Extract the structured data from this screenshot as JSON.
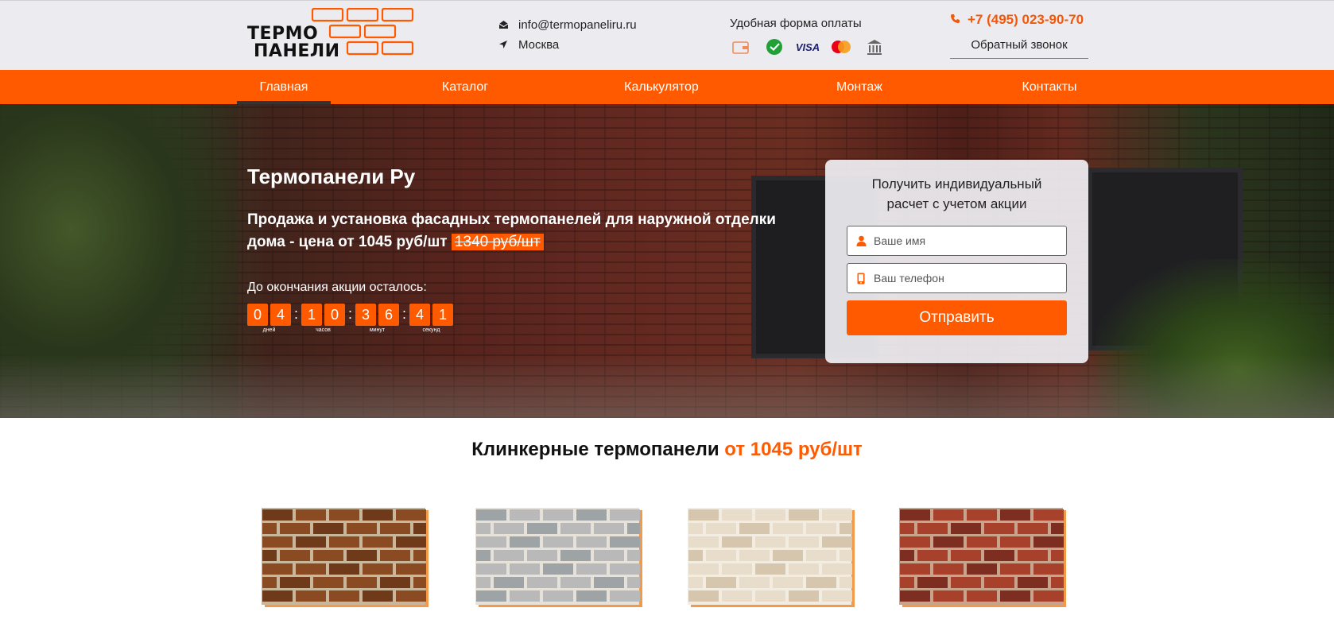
{
  "header": {
    "logo": {
      "line1": "ТЕРМО",
      "line2": "ПАНЕЛИ"
    },
    "email": "info@termopaneliru.ru",
    "city": "Москва",
    "payment_title": "Удобная форма оплаты",
    "payment_icons": [
      "wallet-icon",
      "sberbank-icon",
      "visa-icon",
      "mastercard-icon",
      "bank-icon"
    ],
    "visa_text": "VISA",
    "phone": "+7 (495) 023-90-70",
    "callback_label": "Обратный звонок"
  },
  "nav": {
    "items": [
      {
        "label": "Главная",
        "active": true
      },
      {
        "label": "Каталог",
        "active": false
      },
      {
        "label": "Калькулятор",
        "active": false
      },
      {
        "label": "Монтаж",
        "active": false
      },
      {
        "label": "Контакты",
        "active": false
      }
    ]
  },
  "hero": {
    "title": "Термопанели Ру",
    "subtitle_main": "Продажа и установка фасадных термопанелей для наружной отделки дома - цена от 1045 руб/шт",
    "old_price": "1340 руб/шт",
    "countdown_label": "До окончания акции осталось:",
    "countdown": [
      {
        "digits": [
          "0",
          "4"
        ],
        "unit": "дней"
      },
      {
        "digits": [
          "1",
          "0"
        ],
        "unit": "часов"
      },
      {
        "digits": [
          "3",
          "6"
        ],
        "unit": "минут"
      },
      {
        "digits": [
          "4",
          "1"
        ],
        "unit": "секунд"
      }
    ],
    "countdown_separator": ":"
  },
  "form": {
    "title": "Получить индивидуальный расчет с учетом акции",
    "name_placeholder": "Ваше имя",
    "phone_placeholder": "Ваш телефон",
    "submit_label": "Отправить"
  },
  "catalog": {
    "title": "Клинкерные термопанели",
    "title_accent": "от 1045 руб/шт",
    "panels": [
      {
        "name": "panel-brown",
        "brick": "#8a4a22",
        "brick_alt": "#6e3a1a",
        "mortar": "#c8b79a"
      },
      {
        "name": "panel-grey",
        "brick": "#b9b9b9",
        "brick_alt": "#9ea3a6",
        "mortar": "#e6e2da"
      },
      {
        "name": "panel-cream",
        "brick": "#e8dccb",
        "brick_alt": "#d6c6ad",
        "mortar": "#f3ece1"
      },
      {
        "name": "panel-red",
        "brick": "#a8412c",
        "brick_alt": "#7e2e20",
        "mortar": "#c9a48c"
      }
    ]
  },
  "colors": {
    "accent": "#ff5a00",
    "header_bg": "#ececf0"
  }
}
